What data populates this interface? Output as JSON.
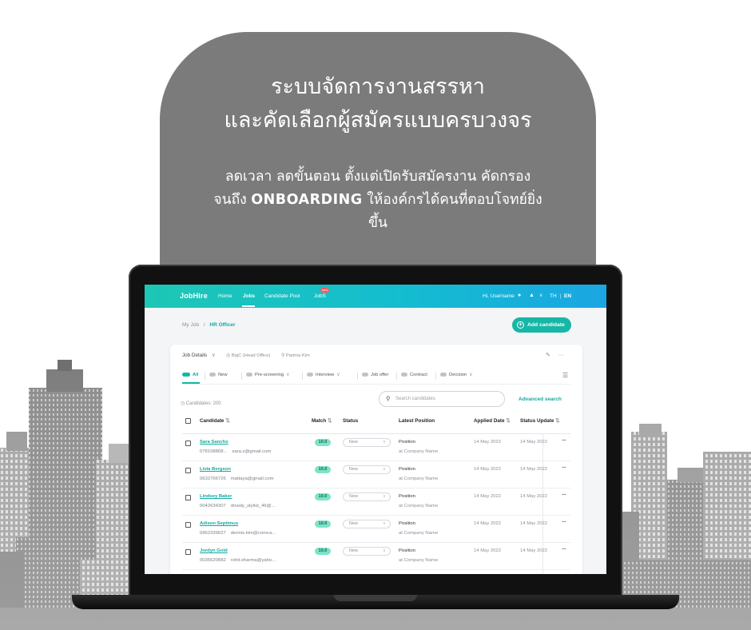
{
  "headline": {
    "line1": "ระบบจัดการงานสรรหา",
    "line2": "และคัดเลือกผู้สมัครแบบครบวงจร"
  },
  "subline": {
    "part1": "ลดเวลา ลดขั้นตอน ตั้งแต่เปิดรับสมัครงาน คัดกรอง จนถึง ",
    "highlight": "ONBOARDING",
    "part2": " ให้องค์กรได้คนที่ตอบโจทย์ยิ่งขึ้น"
  },
  "colors": {
    "bubble": "#7b7b7b",
    "brand_teal": "#16b7a6",
    "nav_gradient_start": "#1dc7b5",
    "nav_gradient_end": "#1aa6e3",
    "match_badge": "#7fe3c6"
  },
  "app": {
    "navbar": {
      "logo": "JobHire",
      "items": [
        "Home",
        "Jobs",
        "Candidate Pool",
        "JobS"
      ],
      "active": "Jobs",
      "badge": "new",
      "user_greeting": "Hi, Username",
      "icons": [
        "user-icon",
        "bell-icon",
        "chevron-down-icon"
      ],
      "lang_th": "TH",
      "lang_sep": "|",
      "lang_en": "EN"
    },
    "breadcrumb": {
      "root": "My Job",
      "sep": "/",
      "current": "HR Officer"
    },
    "add_button": "Add candidate",
    "card": {
      "job_details": "Job Details",
      "company": "BigC (Head Office)",
      "owner": "Parima Kim",
      "tabs": [
        {
          "label": "All",
          "icon": "tag-icon",
          "active": true
        },
        {
          "label": "New",
          "icon": "tag-icon"
        },
        {
          "label": "Pre-screening",
          "icon": "tag-icon",
          "dropdown": true
        },
        {
          "label": "Interview",
          "icon": "tag-icon",
          "dropdown": true
        },
        {
          "label": "Job offer",
          "icon": "tag-icon"
        },
        {
          "label": "Contract",
          "icon": "tag-icon"
        },
        {
          "label": "Decision",
          "icon": "tag-icon",
          "dropdown": true
        }
      ],
      "candidates_count": "Candidates: 200",
      "search_placeholder": "Search candidates",
      "advanced_search": "Advanced search",
      "columns": [
        "Candidate",
        "Match",
        "Status",
        "Latest Position",
        "Applied Date",
        "Status Update"
      ],
      "rows": [
        {
          "name": "Sara Sancho",
          "phone": "078108868...",
          "email": "sara.s@gmail.com",
          "match": "10.0",
          "status": "New",
          "position": "Position",
          "company": "at Company Name",
          "applied": "14 May 2022",
          "updated": "14 May 2022"
        },
        {
          "name": "Livia Bergson",
          "phone": "0632766726",
          "email": "mattaya@gmail.com",
          "match": "10.0",
          "status": "New",
          "position": "Position",
          "company": "at Company Name",
          "applied": "14 May 2022",
          "updated": "14 May 2022"
        },
        {
          "name": "Lindsey Baker",
          "phone": "0042634307",
          "email": "dowdy_stylist_46@...",
          "match": "10.0",
          "status": "New",
          "position": "Position",
          "company": "at Company Name",
          "applied": "14 May 2022",
          "updated": "14 May 2022"
        },
        {
          "name": "Adison Septimus",
          "phone": "0962339027",
          "email": "dennis.kim@comca...",
          "match": "10.0",
          "status": "New",
          "position": "Position",
          "company": "at Company Name",
          "applied": "14 May 2022",
          "updated": "14 May 2022"
        },
        {
          "name": "Jordyn Gold",
          "phone": "0035620882",
          "email": "rohit.sharma@yaho...",
          "match": "10.0",
          "status": "New",
          "position": "Position",
          "company": "at Company Name",
          "applied": "14 May 2022",
          "updated": "14 May 2022"
        }
      ]
    }
  }
}
